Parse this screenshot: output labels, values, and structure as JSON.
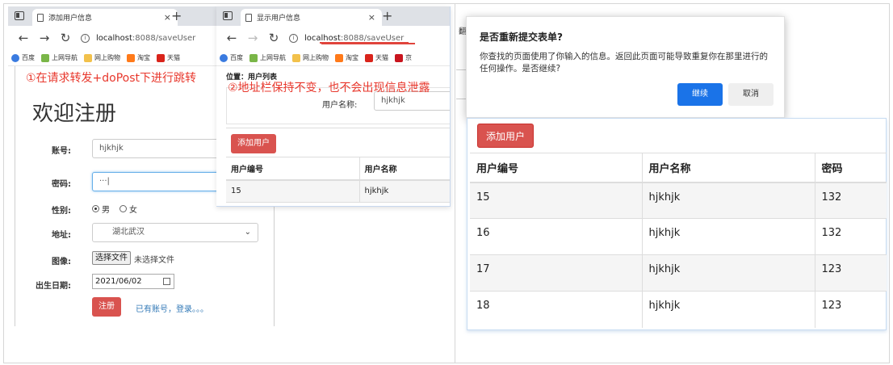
{
  "colors": {
    "annotation": "#e8372c",
    "danger": "#d9534f",
    "primary": "#1a73e8",
    "link": "#337ab7"
  },
  "window1": {
    "tab_title": "添加用户信息",
    "tab_close": "×",
    "new_tab": "+",
    "url_host": "localhost",
    "url_path": ":8088/saveUser",
    "bookmarks": [
      "百度",
      "上网导航",
      "网上购物",
      "淘宝",
      "天猫"
    ],
    "annotation": "①在请求转发+doPost下进行跳转",
    "form": {
      "title": "欢迎注册",
      "account_label": "账号:",
      "account_value": "hjkhjk",
      "password_label": "密码:",
      "password_value": "···|",
      "gender_label": "性别:",
      "gender_male": "男",
      "gender_female": "女",
      "address_label": "地址:",
      "address_value": "湖北武汉",
      "image_label": "图像:",
      "file_button": "选择文件",
      "file_status": "未选择文件",
      "birth_label": "出生日期:",
      "birth_value": "2021/06/02",
      "register_button": "注册",
      "login_link": "已有账号，登录。。。"
    }
  },
  "window2": {
    "tab_title": "显示用户信息",
    "tab_close": "×",
    "new_tab": "+",
    "url_host": "localhost",
    "url_path": ":8088/saveUser",
    "bookmarks": [
      "百度",
      "上网导航",
      "网上购物",
      "淘宝",
      "天猫",
      "京"
    ],
    "annotation": "②地址栏保持不变，也不会出现信息泄露",
    "location": "位置：用户列表",
    "search_label": "用户名称:",
    "search_value": "hjkhjk",
    "add_button": "添加用户",
    "table": {
      "headers": [
        "用户编号",
        "用户名称"
      ],
      "rows": [
        [
          "15",
          "hjkhjk"
        ]
      ]
    }
  },
  "dialog": {
    "title": "是否重新提交表单?",
    "body": "你查找的页面使用了你输入的信息。返回此页面可能导致重复你在那里进行的任何操作。是否继续?",
    "continue_button": "继续",
    "cancel_button": "取消",
    "bg_char": "翻"
  },
  "result": {
    "add_button": "添加用户",
    "headers": [
      "用户编号",
      "用户名称",
      "密码"
    ],
    "rows": [
      [
        "15",
        "hjkhjk",
        "132"
      ],
      [
        "16",
        "hjkhjk",
        "132"
      ],
      [
        "17",
        "hjkhjk",
        "123"
      ],
      [
        "18",
        "hjkhjk",
        "123"
      ]
    ]
  }
}
